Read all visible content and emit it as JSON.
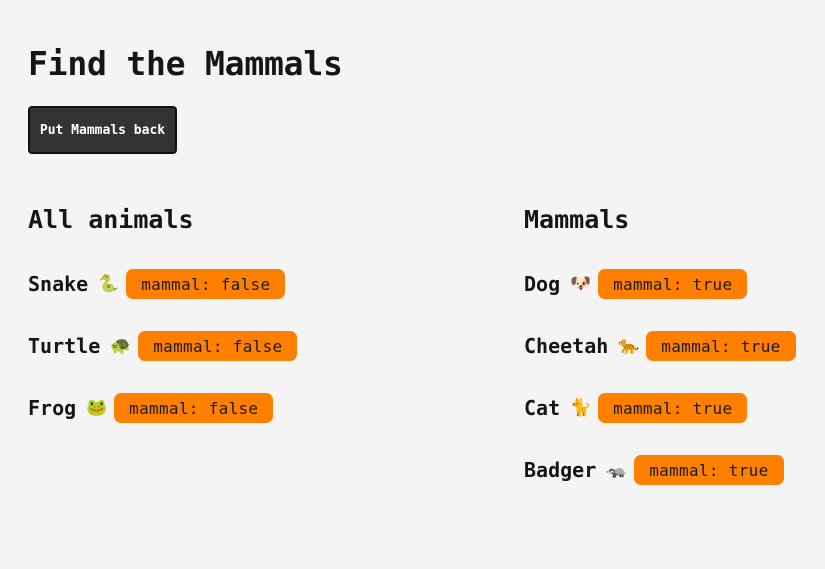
{
  "page": {
    "title": "Find the Mammals",
    "back_button_label": "Put Mammals back"
  },
  "colors": {
    "background": "#f4f4f4",
    "button_bg": "#333333",
    "badge_bg": "#ff8000"
  },
  "badge_key": "mammal:",
  "all_animals": {
    "heading": "All animals",
    "items": [
      {
        "name": "Snake",
        "emoji": "🐍",
        "value": "false"
      },
      {
        "name": "Turtle",
        "emoji": "🐢",
        "value": "false"
      },
      {
        "name": "Frog",
        "emoji": "🐸",
        "value": "false"
      }
    ]
  },
  "mammals": {
    "heading": "Mammals",
    "items": [
      {
        "name": "Dog",
        "emoji": "🐶",
        "value": "true"
      },
      {
        "name": "Cheetah",
        "emoji": "🐆",
        "value": "true"
      },
      {
        "name": "Cat",
        "emoji": "🐈",
        "value": "true"
      },
      {
        "name": "Badger",
        "emoji": "🦡",
        "value": "true"
      }
    ]
  }
}
